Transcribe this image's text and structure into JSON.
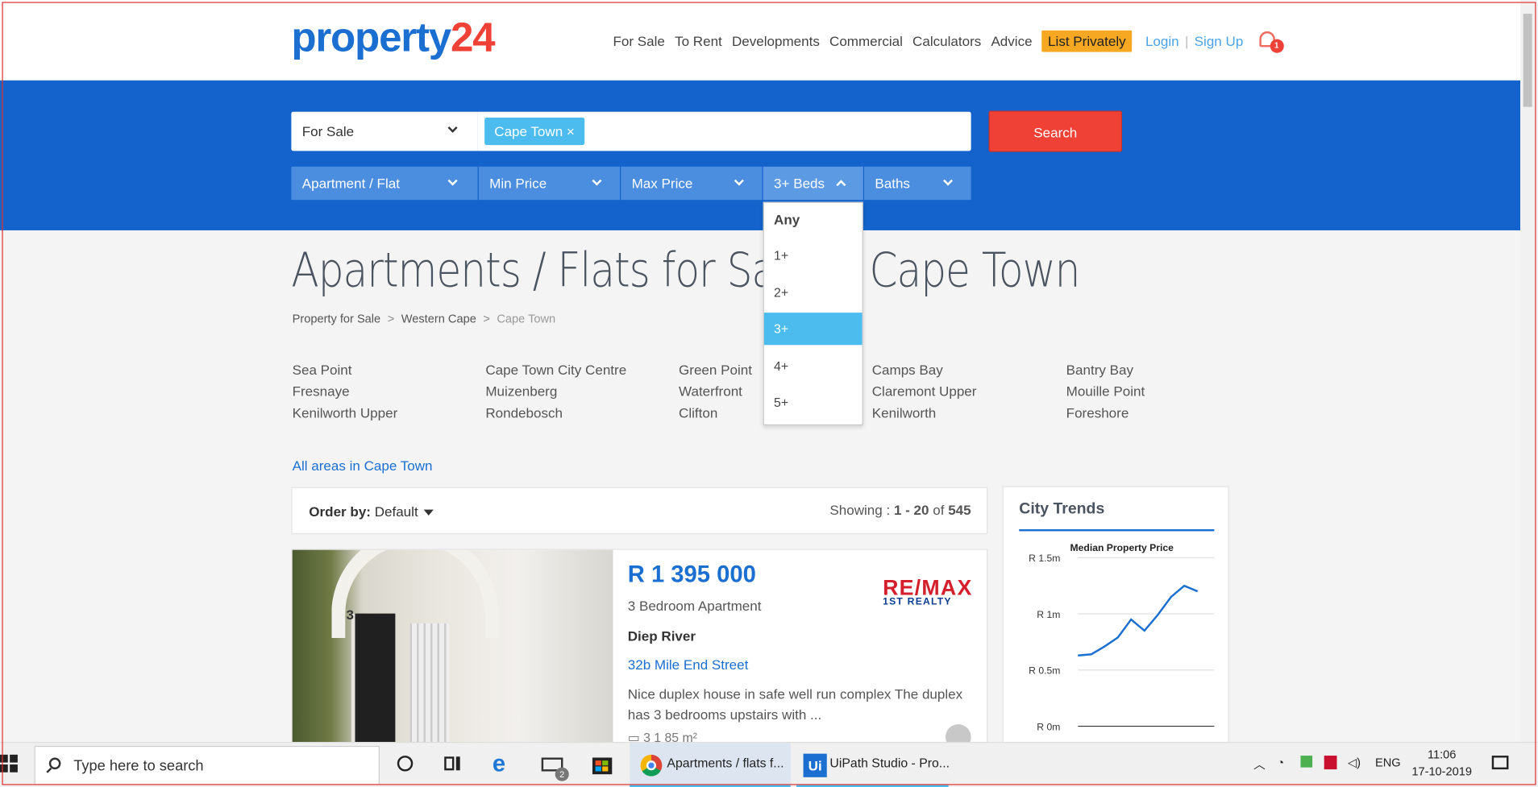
{
  "header": {
    "logo_main": "property",
    "logo_num": "24",
    "nav": [
      "For Sale",
      "To Rent",
      "Developments",
      "Commercial",
      "Calculators",
      "Advice"
    ],
    "list_privately": "List Privately",
    "login": "Login",
    "separator": "|",
    "signup": "Sign Up",
    "notification_count": "1"
  },
  "search": {
    "listing_type": "For Sale",
    "location_chip": "Cape Town",
    "chip_remove": "×",
    "search_button": "Search",
    "filters": {
      "property_type": "Apartment / Flat",
      "min_price": "Min Price",
      "max_price": "Max Price",
      "beds": "3+ Beds",
      "baths": "Baths"
    },
    "beds_options": [
      "Any",
      "1+",
      "2+",
      "3+",
      "4+",
      "5+"
    ],
    "beds_selected": "3+"
  },
  "page": {
    "title": "Apartments / Flats for Sale in Cape Town",
    "breadcrumb": [
      "Property for Sale",
      "Western Cape",
      "Cape Town"
    ],
    "breadcrumb_sep": ">",
    "areas": [
      [
        "Sea Point",
        "Fresnaye",
        "Kenilworth Upper"
      ],
      [
        "Cape Town City Centre",
        "Muizenberg",
        "Rondebosch"
      ],
      [
        "Green Point",
        "Waterfront",
        "Clifton"
      ],
      [
        "Camps Bay",
        "Claremont Upper",
        "Kenilworth"
      ],
      [
        "Bantry Bay",
        "Mouille Point",
        "Foreshore"
      ]
    ],
    "all_areas": "All areas in Cape Town"
  },
  "results": {
    "order_label": "Order by:",
    "order_value": "Default",
    "showing_label": "Showing :",
    "showing_range": "1 - 20",
    "showing_of": "of",
    "showing_total": "545"
  },
  "listing": {
    "photo_number": "3",
    "price": "R 1 395 000",
    "type": "3 Bedroom Apartment",
    "suburb": "Diep River",
    "street": "32b Mile End Street",
    "description": "Nice duplex house in safe well run complex The duplex has 3 bedrooms upstairs with ...",
    "features": "3        1        85 m²",
    "agency_line1": "RE/MAX",
    "agency_line2": "1ST REALTY"
  },
  "trends": {
    "title": "City Trends",
    "chart_data": {
      "type": "line",
      "title": "Median Property Price",
      "y_ticks": [
        "R 1.5m",
        "R 1m",
        "R 0.5m",
        "R 0m"
      ],
      "ylim": [
        0,
        1500000
      ],
      "values": [
        630000,
        640000,
        710000,
        790000,
        950000,
        850000,
        990000,
        1150000,
        1250000,
        1200000
      ],
      "color": "#1a6fd1"
    }
  },
  "taskbar": {
    "search_placeholder": "Type here to search",
    "mail_badge": "2",
    "chrome_label": "Apartments / flats f...",
    "uipath_label": "UiPath Studio - Pro...",
    "lang": "ENG",
    "time": "11:06",
    "date": "17-10-2019"
  }
}
